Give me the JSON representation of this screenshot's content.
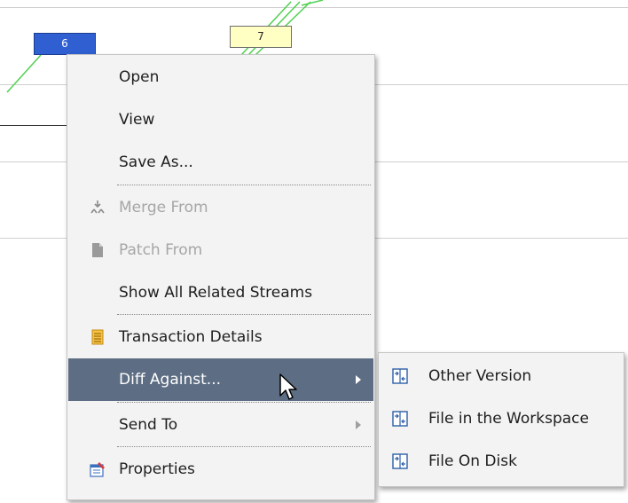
{
  "graph": {
    "nodes": [
      "6",
      "7"
    ]
  },
  "context_menu": {
    "items": [
      {
        "label": "Open",
        "icon": "none",
        "enabled": true
      },
      {
        "label": "View",
        "icon": "none",
        "enabled": true
      },
      {
        "label": "Save As...",
        "icon": "none",
        "enabled": true
      },
      {
        "label": "Merge From",
        "icon": "merge-icon",
        "enabled": false
      },
      {
        "label": "Patch From",
        "icon": "document-icon",
        "enabled": false
      },
      {
        "label": "Show All Related Streams",
        "icon": "none",
        "enabled": true
      },
      {
        "label": "Transaction Details",
        "icon": "notepad-icon",
        "enabled": true
      },
      {
        "label": "Diff Against...",
        "icon": "none",
        "enabled": true,
        "highlighted": true,
        "submenu": true
      },
      {
        "label": "Send To",
        "icon": "none",
        "enabled": true,
        "submenu": true
      },
      {
        "label": "Properties",
        "icon": "properties-icon",
        "enabled": true
      }
    ]
  },
  "submenu": {
    "items": [
      {
        "label": "Other Version",
        "icon": "diff-icon"
      },
      {
        "label": "File in the Workspace",
        "icon": "diff-icon"
      },
      {
        "label": "File On Disk",
        "icon": "diff-icon"
      }
    ]
  },
  "colors": {
    "highlight": "#5d6d83",
    "node_blue": "#2f5fd1",
    "node_yellow": "#ffffc4",
    "graph_line": "#4fd04f"
  }
}
